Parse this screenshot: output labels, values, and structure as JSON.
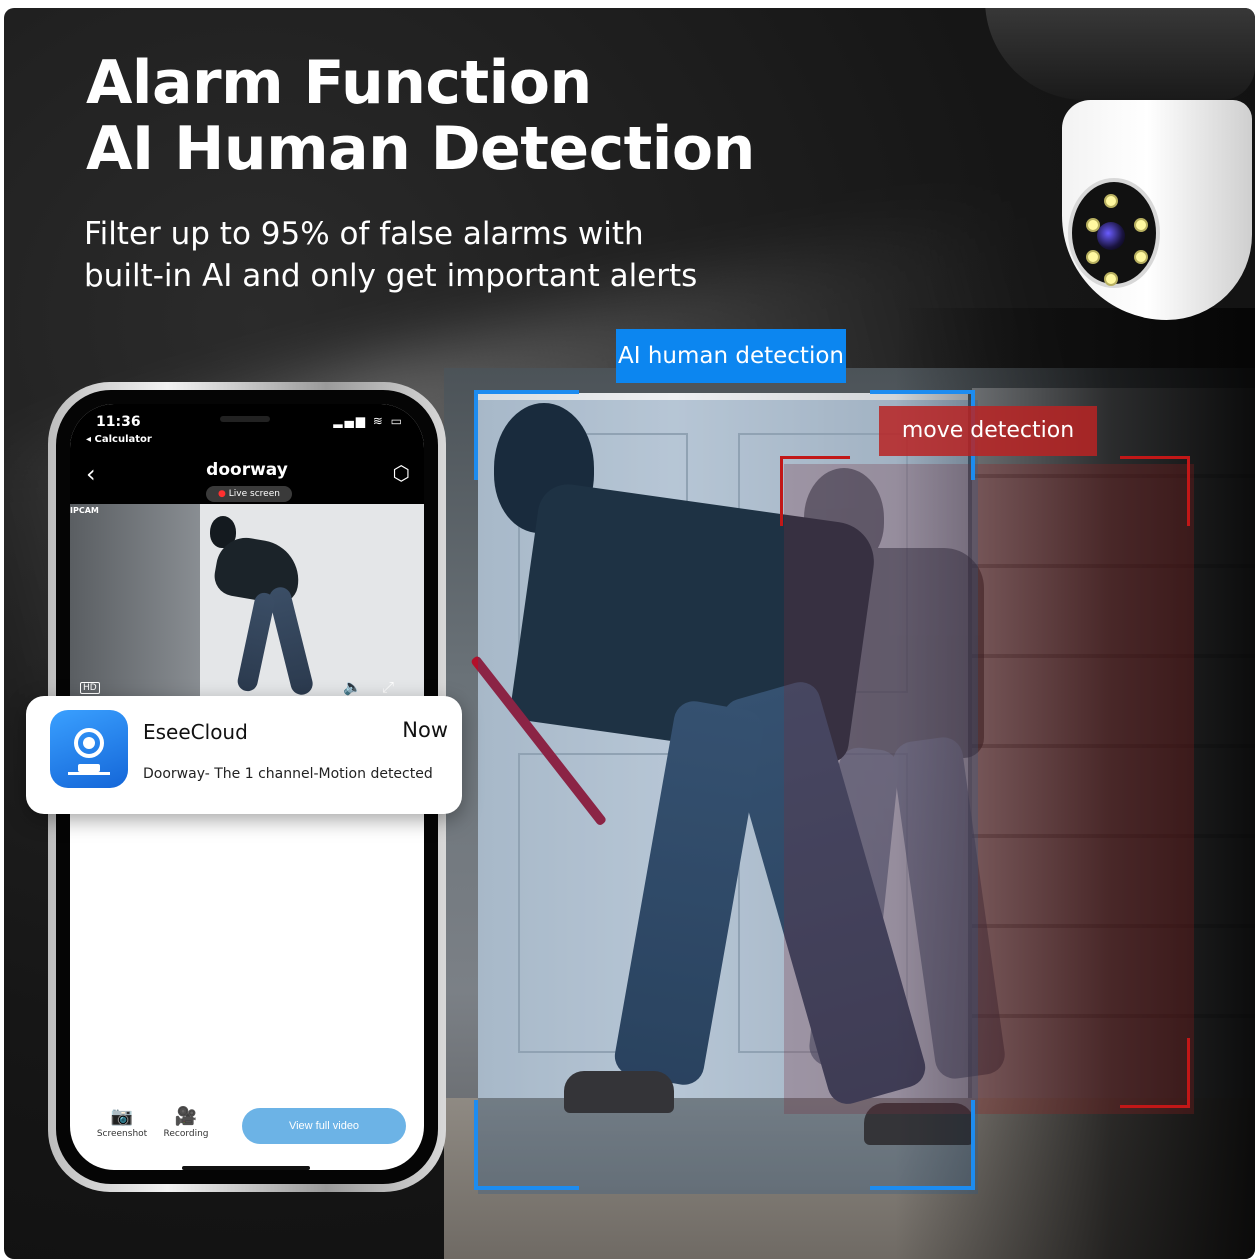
{
  "headline": {
    "line1": "Alarm Function",
    "line2": "AI Human Detection"
  },
  "subheadline": {
    "line1": "Filter up to 95% of false alarms with",
    "line2": "built-in AI and only get important alerts"
  },
  "overlays": {
    "ai_label": "AI human detection",
    "move_label": "move detection"
  },
  "phone": {
    "status": {
      "time": "11:36",
      "back_app": "◂ Calculator",
      "icons": "▂▄▆ ≋ ▭"
    },
    "nav": {
      "back_icon": "‹",
      "title": "doorway",
      "live_dot": "●",
      "live_label": "Live screen",
      "settings_icon": "⬡"
    },
    "feed": {
      "watermark": "IPCAM",
      "hd_label": "HD",
      "controls": "🔈⤢"
    },
    "toolbar": {
      "screenshot_icon": "📷",
      "screenshot_label": "Screenshot",
      "recording_icon": "🎥",
      "recording_label": "Recording",
      "view_button": "View full video"
    }
  },
  "notification": {
    "app_name": "EseeCloud",
    "time": "Now",
    "message": "Doorway- The 1 channel-Motion detected"
  },
  "colors": {
    "ai_blue": "#0c86f0",
    "move_red": "#b92323",
    "view_button": "#6cb3e6"
  }
}
